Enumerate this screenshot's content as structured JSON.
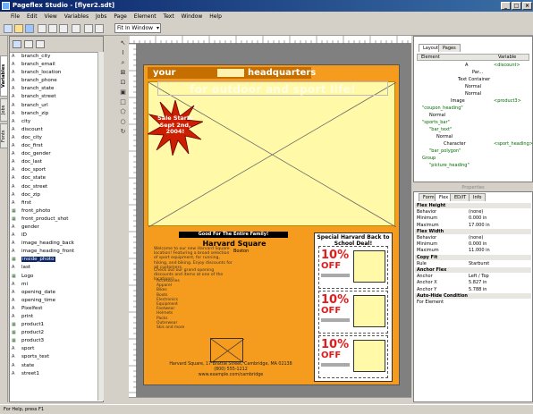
{
  "window": {
    "title": "Pageflex Studio - [flyer2.sdt]"
  },
  "menu": [
    "File",
    "Edit",
    "View",
    "Variables",
    "Jobs",
    "Page",
    "Element",
    "Text",
    "Window",
    "Help"
  ],
  "toolbar": {
    "zoom": "Fit In Window"
  },
  "left_tabs": [
    "Variables",
    "Jobs",
    "Fonts"
  ],
  "variables": [
    {
      "name": "branch_city",
      "icon": "A"
    },
    {
      "name": "branch_email",
      "icon": "A"
    },
    {
      "name": "branch_location",
      "icon": "A"
    },
    {
      "name": "branch_phone",
      "icon": "A"
    },
    {
      "name": "branch_state",
      "icon": "A"
    },
    {
      "name": "branch_street",
      "icon": "A"
    },
    {
      "name": "branch_url",
      "icon": "A"
    },
    {
      "name": "branch_zip",
      "icon": "A"
    },
    {
      "name": "city",
      "icon": "A"
    },
    {
      "name": "discount",
      "icon": "A"
    },
    {
      "name": "doc_city",
      "icon": "A"
    },
    {
      "name": "doc_first",
      "icon": "A"
    },
    {
      "name": "doc_gender",
      "icon": "A"
    },
    {
      "name": "doc_last",
      "icon": "A"
    },
    {
      "name": "doc_sport",
      "icon": "A"
    },
    {
      "name": "doc_state",
      "icon": "A"
    },
    {
      "name": "doc_street",
      "icon": "A"
    },
    {
      "name": "doc_zip",
      "icon": "A"
    },
    {
      "name": "first",
      "icon": "A"
    },
    {
      "name": "front_photo",
      "icon": "img"
    },
    {
      "name": "front_product_shot",
      "icon": "img"
    },
    {
      "name": "gender",
      "icon": "A"
    },
    {
      "name": "ID",
      "icon": "A"
    },
    {
      "name": "image_heading_back",
      "icon": "A"
    },
    {
      "name": "image_heading_front",
      "icon": "A"
    },
    {
      "name": "inside_photo",
      "icon": "img",
      "selected": true
    },
    {
      "name": "last",
      "icon": "A"
    },
    {
      "name": "Logo",
      "icon": "img"
    },
    {
      "name": "mi",
      "icon": "A"
    },
    {
      "name": "opening_date",
      "icon": "A"
    },
    {
      "name": "opening_time",
      "icon": "A"
    },
    {
      "name": "Pixelfest",
      "icon": "A"
    },
    {
      "name": "print",
      "icon": "A"
    },
    {
      "name": "product1",
      "icon": "img"
    },
    {
      "name": "product2",
      "icon": "img"
    },
    {
      "name": "product3",
      "icon": "img"
    },
    {
      "name": "sport",
      "icon": "A"
    },
    {
      "name": "sports_text",
      "icon": "A"
    },
    {
      "name": "state",
      "icon": "A"
    },
    {
      "name": "street1",
      "icon": "A"
    }
  ],
  "flyer": {
    "header_left": "your",
    "header_right": "headquarters",
    "big_title": "for outdoor and sport life!",
    "starburst": [
      "Sale Starts",
      "Sept 2nd,",
      "2004!"
    ],
    "center_banner": "Good For The Entire Family!",
    "center_title": "Harvard Square",
    "city_label": "Boston",
    "body_text": "Welcome to our new Harvard Square location! Featuring a broad selection of sport equipment, for running, hiking, and biking. Enjoy discounts for all customers.",
    "body_text2": "Check out our grand opening discounts and items at one of the locations!",
    "bullets": [
      "Accessories",
      "Apparel",
      "Bikes",
      "Boots",
      "Electronics",
      "Equipment",
      "Footwear",
      "Helmets",
      "Packs",
      "Outerwear",
      "Skis and more"
    ],
    "address": [
      "Harvard Square, 17 Brattle Street, Cambridge, MA 02138",
      "(800) 555-1212",
      "www.example.com/cambridge"
    ],
    "coupon_title": "Special Harvard Back to School Deal!",
    "coupons": [
      {
        "pct": "10%",
        "off": "OFF"
      },
      {
        "pct": "10%",
        "off": "OFF"
      },
      {
        "pct": "10%",
        "off": "OFF"
      }
    ]
  },
  "right_tabs": [
    "Layout",
    "Pages"
  ],
  "layout_header": {
    "element": "Element",
    "variable": "Variable"
  },
  "layout_tree": [
    {
      "text": "A",
      "val": "<discount>"
    },
    {
      "text": "Par...",
      "val": ""
    },
    {
      "text": "Text Container",
      "val": ""
    },
    {
      "text": "Normal",
      "val": ""
    },
    {
      "text": "Normal",
      "val": ""
    },
    {
      "text": "Image",
      "val": "<product3>"
    },
    {
      "text": "\"coupon_heading\"",
      "val": ""
    },
    {
      "text": "Normal",
      "val": ""
    },
    {
      "text": "\"sports_bar\"",
      "val": ""
    },
    {
      "text": "\"bar_text\"",
      "val": ""
    },
    {
      "text": "Normal",
      "val": ""
    },
    {
      "text": "Character",
      "val": "<sport_heading>"
    },
    {
      "text": "\"bar_polygon\"",
      "val": ""
    },
    {
      "text": "Group",
      "val": ""
    },
    {
      "text": "\"picture_heading\"",
      "val": ""
    }
  ],
  "props_tabs": [
    "Form",
    "Flex",
    "ED/IT",
    "Info"
  ],
  "props": [
    {
      "k": "Flex Height",
      "v": "",
      "sec": true
    },
    {
      "k": "Behavior",
      "v": "(none)"
    },
    {
      "k": "Minimum",
      "v": "0.000 in"
    },
    {
      "k": "Maximum",
      "v": "17.000 in"
    },
    {
      "k": "Flex Width",
      "v": "",
      "sec": true
    },
    {
      "k": "Behavior",
      "v": "(none)"
    },
    {
      "k": "Minimum",
      "v": "0.000 in"
    },
    {
      "k": "Maximum",
      "v": "11.000 in"
    },
    {
      "k": "Copy Fit",
      "v": "",
      "sec": true
    },
    {
      "k": "Rule",
      "v": "Starburst"
    },
    {
      "k": "Anchor Flex",
      "v": "",
      "sec": true
    },
    {
      "k": "Anchor",
      "v": "Left / Top"
    },
    {
      "k": "Anchor X",
      "v": "5.827 in"
    },
    {
      "k": "Anchor Y",
      "v": "5.788 in"
    },
    {
      "k": "Auto-Hide Condition",
      "v": "",
      "sec": true
    },
    {
      "k": "For Element",
      "v": ""
    }
  ],
  "status": {
    "text": "For Help, press F1"
  },
  "colors": {
    "accent": "#f59b1e",
    "page_yellow": "#fff9a8",
    "titlebar": "#0a246a",
    "coupon_red": "#e41b1b"
  }
}
